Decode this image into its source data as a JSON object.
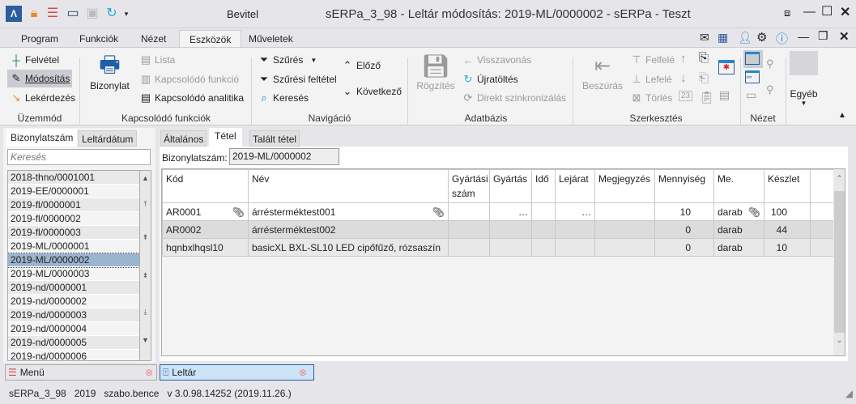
{
  "window": {
    "ribbon_context": "Bevitel",
    "title": "sERPa_3_98 - Leltár módosítás: 2019-ML/0000002 - sERPa - Teszt"
  },
  "ribbon_tabs": [
    "Program",
    "Funkciók",
    "Nézet",
    "Eszközök",
    "Műveletek"
  ],
  "ribbon": {
    "uzemmod": {
      "label": "Üzemmód",
      "items": [
        "Felvétel",
        "Módosítás",
        "Lekérdezés"
      ]
    },
    "kapcsolodo": {
      "label": "Kapcsolódó funkciók",
      "bizonylat": "Bizonylat",
      "items": [
        "Lista",
        "Kapcsolódó funkció",
        "Kapcsolódó analitika"
      ]
    },
    "navigacio": {
      "label": "Navigáció",
      "items": [
        "Szűrés",
        "Szűrési feltétel",
        "Keresés"
      ],
      "prev": "Előző",
      "next": "Következő"
    },
    "adatbazis": {
      "label": "Adatbázis",
      "rogzites": "Rögzítés",
      "items": [
        "Visszavonás",
        "Újratöltés",
        "Direkt szinkronizálás"
      ]
    },
    "szerkesztes": {
      "label": "Szerkesztés",
      "beszuras": "Beszúrás",
      "items": [
        "Felfelé",
        "Lefelé",
        "Törlés"
      ]
    },
    "nezet": {
      "label": "Nézet"
    },
    "egyeb": "Egyéb"
  },
  "left": {
    "tabs": [
      "Bizonylatszám",
      "Leltárdátum"
    ],
    "search_placeholder": "Keresés",
    "items": [
      "2018-thno/0001001",
      "2019-EE/0000001",
      "2019-fl/0000001",
      "2019-fl/0000002",
      "2019-fl/0000003",
      "2019-ML/0000001",
      "2019-ML/0000002",
      "2019-ML/0000003",
      "2019-nd/0000001",
      "2019-nd/0000002",
      "2019-nd/0000003",
      "2019-nd/0000004",
      "2019-nd/0000005",
      "2019-nd/0000006"
    ],
    "selected": "2019-ML/0000002"
  },
  "main": {
    "tabs": [
      "Általános",
      "Tétel",
      "Talált tétel"
    ],
    "doc_label": "Bizonylatszám:",
    "doc_value": "2019-ML/0000002",
    "columns": [
      "Kód",
      "Név",
      "Gyártási szám",
      "Gyártás",
      "Idő",
      "Lejárat",
      "Megjegyzés",
      "Mennyiség",
      "Me.",
      "Készlet"
    ],
    "rows": [
      {
        "kod": "AR0001",
        "nev": "árrésterméktest001",
        "qty": "10",
        "me": "darab",
        "stock": "100",
        "ellipsis": "…"
      },
      {
        "kod": "AR0002",
        "nev": "árrésterméktest002",
        "qty": "0",
        "me": "darab",
        "stock": "44"
      },
      {
        "kod": "hqnbxlhqsl10",
        "nev": "basicXL BXL-SL10 LED cipőfűző, rózsaszín",
        "qty": "0",
        "me": "darab",
        "stock": "10"
      }
    ]
  },
  "bottom_tabs": {
    "menu": "Menü",
    "leltar": "Leltár"
  },
  "status": {
    "db": "sERPa_3_98",
    "year": "2019",
    "user": "szabo.bence",
    "version": "v 3.0.98.14252 (2019.11.26.)"
  }
}
